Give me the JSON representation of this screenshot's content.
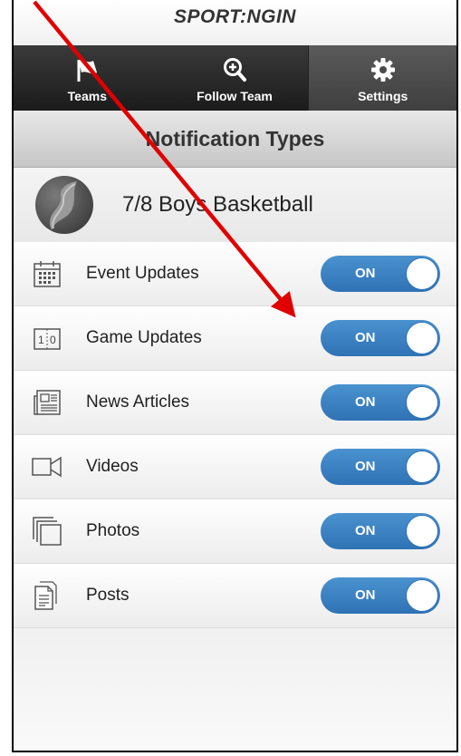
{
  "app": {
    "logo_text": "SPORT:NGIN"
  },
  "nav": {
    "tabs": [
      {
        "label": "Teams",
        "icon": "flag-icon",
        "active": false
      },
      {
        "label": "Follow Team",
        "icon": "zoom-in-icon",
        "active": false
      },
      {
        "label": "Settings",
        "icon": "gear-icon",
        "active": true
      }
    ]
  },
  "page": {
    "title": "Notification Types"
  },
  "team": {
    "name": "7/8 Boys Basketball"
  },
  "notifications": [
    {
      "label": "Event Updates",
      "icon": "calendar-icon",
      "state": "ON"
    },
    {
      "label": "Game Updates",
      "icon": "scoreboard-icon",
      "state": "ON"
    },
    {
      "label": "News Articles",
      "icon": "newspaper-icon",
      "state": "ON"
    },
    {
      "label": "Videos",
      "icon": "video-camera-icon",
      "state": "ON"
    },
    {
      "label": "Photos",
      "icon": "photos-icon",
      "state": "ON"
    },
    {
      "label": "Posts",
      "icon": "document-icon",
      "state": "ON"
    }
  ],
  "colors": {
    "toggle_on": "#3a7fc2",
    "navbar": "#262626",
    "annotation_arrow": "#e00000"
  }
}
